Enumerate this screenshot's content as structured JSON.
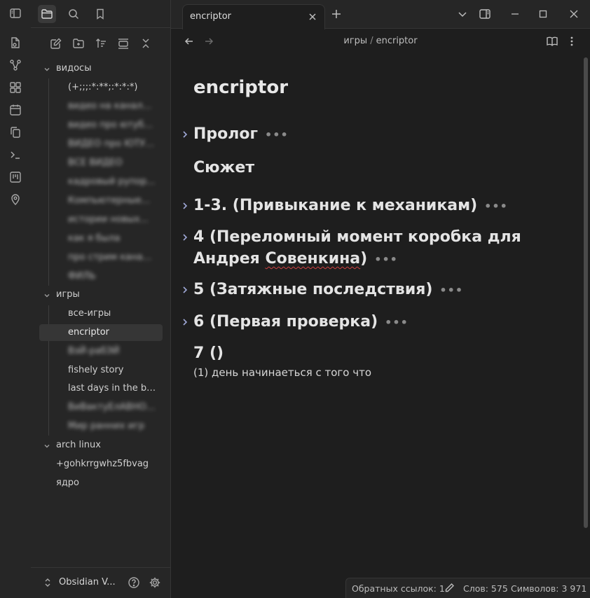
{
  "ribbon": {
    "icons": [
      "sidebar-toggle-icon",
      "files-icon",
      "graph-icon",
      "blocks-icon",
      "calendar-icon",
      "copy-icon",
      "terminal-icon",
      "kanban-icon",
      "map-pin-icon"
    ]
  },
  "sidebar": {
    "top_icons": [
      "folder-icon",
      "search-icon",
      "bookmark-icon"
    ],
    "nav_icons": [
      "new-note-icon",
      "new-folder-icon",
      "sort-icon",
      "collapse-all-icon",
      "close-icon"
    ],
    "tree": {
      "folder_videos": "видосы",
      "videos_items": [
        "(+;;;:*:**;:*:*:*)",
        "видео на канале и...",
        "видео про ютуба...",
        "ВИДЕО про ЮТУБЕ...",
        "ВСЕ ВИДЕО",
        "кадровый рупор...",
        "Компьютерные...",
        "истории новых...",
        "как я была",
        "про стрим канала...",
        "ФИЛЬ"
      ],
      "folder_games": "игры",
      "games_items": [
        "все-игры",
        "encriptor",
        "ВэЙ-рабЭЙ",
        "fishely story",
        "last days in the bu...",
        "ВиВактуЕлАВНОЕ...",
        "Мир ранних игр"
      ],
      "folder_arch": "arch linux",
      "root_file_1": "+gohkrrgwhz5fbvag",
      "root_file_2": "ядро"
    },
    "vault_name": "Obsidian V..."
  },
  "tab": {
    "title": "encriptor"
  },
  "breadcrumb": {
    "folder": "игры",
    "sep": "/",
    "file": "encriptor"
  },
  "note": {
    "title": "encriptor",
    "h_prologue": "Пролог",
    "h_plot": "Сюжет",
    "h_1": "1-3. (Привыкание к механикам)",
    "h_4a": "4 (Переломный момент коробка для Андрея ",
    "h_4b": "Совенкина",
    "h_4c": ")",
    "h_5": "5 (Затяжные последствия)",
    "h_6": "6 (Первая проверка)",
    "h_7": "7 ()",
    "para_1": "(1) день начинаеться с того что",
    "dots": "•••"
  },
  "status": {
    "backlinks": "Обратных ссылок: 1",
    "words": "Слов: 575",
    "chars": "Символов: 3 971"
  }
}
